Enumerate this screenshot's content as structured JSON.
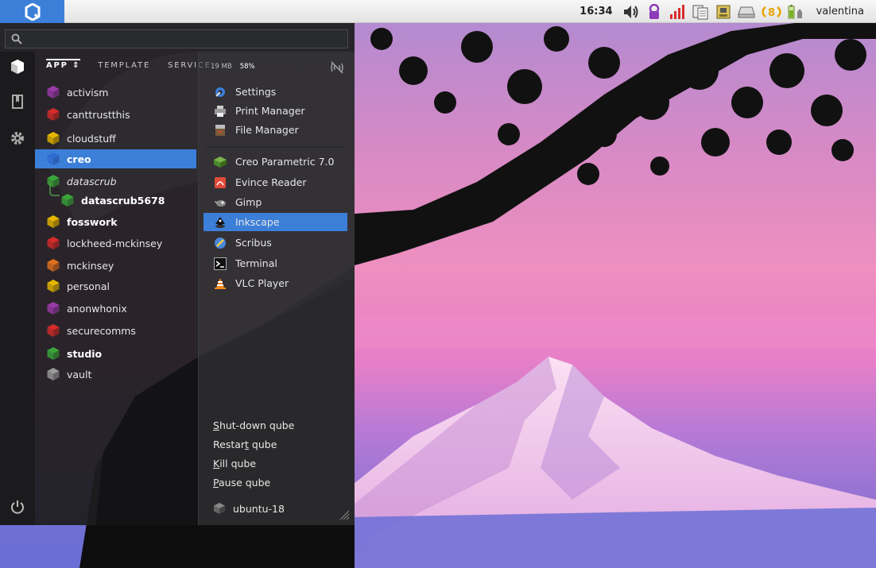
{
  "panel": {
    "clock": "16:34",
    "updates_badge": "8",
    "username": "valentina",
    "tray_icons": [
      "volume-icon",
      "purple-qube-icon",
      "network-bars-icon",
      "clipboard-icon",
      "devices-icon",
      "disk-icon",
      "updates-icon",
      "battery-icon"
    ]
  },
  "search": {
    "value": "",
    "placeholder": ""
  },
  "tabs": {
    "app": "APP",
    "template": "TEMPLATE",
    "service": "SERVICE"
  },
  "stats": {
    "memory": "19 MB",
    "cpu": "58%"
  },
  "qubes": [
    {
      "name": "activism",
      "color": "#9b3ba8",
      "style": "normal"
    },
    {
      "name": "canttrustthis",
      "color": "#d62b2b",
      "style": "normal"
    },
    {
      "name": "cloudstuff",
      "color": "#e8b800",
      "style": "normal"
    },
    {
      "name": "creo",
      "color": "#2e6ad0",
      "style": "bold",
      "selected": true
    },
    {
      "name": "datascrub",
      "color": "#3aa63a",
      "style": "italic"
    },
    {
      "name": "datascrub5678",
      "color": "#3aa63a",
      "style": "bold",
      "child": true
    },
    {
      "name": "fosswork",
      "color": "#e8b800",
      "style": "bold"
    },
    {
      "name": "lockheed-mckinsey",
      "color": "#d62b2b",
      "style": "normal"
    },
    {
      "name": "mckinsey",
      "color": "#e0701f",
      "style": "normal"
    },
    {
      "name": "personal",
      "color": "#e8b800",
      "style": "normal"
    },
    {
      "name": "anonwhonix",
      "color": "#9b3ba8",
      "style": "normal"
    },
    {
      "name": "securecomms",
      "color": "#d62b2b",
      "style": "normal"
    },
    {
      "name": "studio",
      "color": "#3aa63a",
      "style": "bold"
    },
    {
      "name": "vault",
      "color": "#9a9a9a",
      "style": "normal"
    }
  ],
  "system_apps": [
    {
      "label": "Settings",
      "icon": "settings-icon"
    },
    {
      "label": "Print Manager",
      "icon": "printer-icon"
    },
    {
      "label": "File Manager",
      "icon": "file-manager-icon"
    }
  ],
  "apps": [
    {
      "label": "Creo Parametric 7.0",
      "icon": "creo-icon"
    },
    {
      "label": "Evince Reader",
      "icon": "evince-icon"
    },
    {
      "label": "Gimp",
      "icon": "gimp-icon"
    },
    {
      "label": "Inkscape",
      "icon": "inkscape-icon",
      "selected": true
    },
    {
      "label": "Scribus",
      "icon": "scribus-icon"
    },
    {
      "label": "Terminal",
      "icon": "terminal-icon"
    },
    {
      "label": "VLC Player",
      "icon": "vlc-icon"
    }
  ],
  "actions": {
    "shutdown": {
      "pre": "",
      "key": "S",
      "post": "hut-down qube"
    },
    "restart": {
      "pre": "Restar",
      "key": "t",
      "post": " qube"
    },
    "kill": {
      "pre": "",
      "key": "K",
      "post": "ill qube"
    },
    "pause": {
      "pre": "",
      "key": "P",
      "post": "ause qube"
    }
  },
  "template": "ubuntu-18"
}
